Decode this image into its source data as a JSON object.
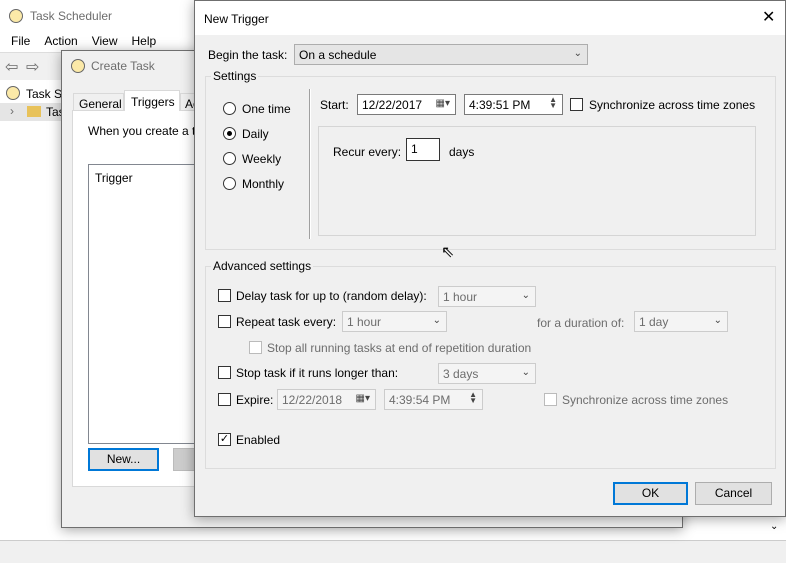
{
  "scheduler": {
    "title": "Task Scheduler",
    "menu": [
      "File",
      "Action",
      "View",
      "Help"
    ],
    "tree": [
      "Task Sc",
      "Tas"
    ]
  },
  "create_task": {
    "title": "Create Task",
    "tabs": [
      "General",
      "Triggers",
      "Ac"
    ],
    "intro": "When you create a ta",
    "list_header": "Trigger",
    "new_button": "New..."
  },
  "new_trigger": {
    "title": "New Trigger",
    "begin_label": "Begin the task:",
    "begin_value": "On a schedule",
    "settings_label": "Settings",
    "schedule_options": [
      "One time",
      "Daily",
      "Weekly",
      "Monthly"
    ],
    "selected_option": "Daily",
    "start_label": "Start:",
    "start_date": "12/22/2017",
    "start_time": "4:39:51 PM",
    "sync_label": "Synchronize across time zones",
    "recur_label": "Recur every:",
    "recur_value": "1",
    "recur_unit": "days",
    "advanced_label": "Advanced settings",
    "delay_label": "Delay task for up to (random delay):",
    "delay_value": "1 hour",
    "repeat_label": "Repeat task every:",
    "repeat_value": "1 hour",
    "duration_label": "for a duration of:",
    "duration_value": "1 day",
    "stop_all_label": "Stop all running tasks at end of repetition duration",
    "stop_label": "Stop task if it runs longer than:",
    "stop_value": "3 days",
    "expire_label": "Expire:",
    "expire_date": "12/22/2018",
    "expire_time": "4:39:54 PM",
    "expire_sync_label": "Synchronize across time zones",
    "enabled_label": "Enabled",
    "enabled": true,
    "ok": "OK",
    "cancel": "Cancel"
  }
}
